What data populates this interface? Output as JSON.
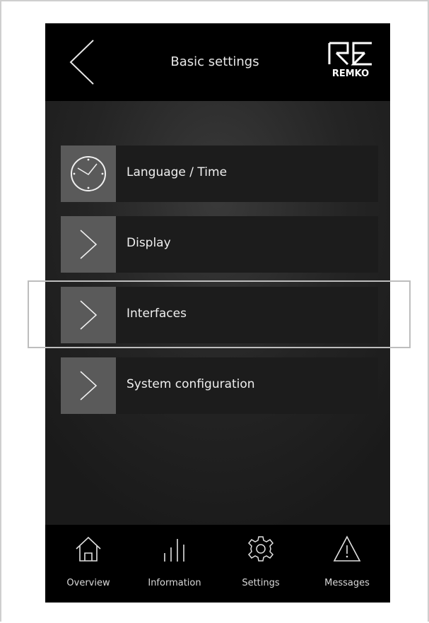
{
  "header": {
    "title": "Basic settings",
    "logo_text": "REMKO"
  },
  "menu": {
    "items": [
      {
        "label": "Language / Time",
        "icon": "clock-icon"
      },
      {
        "label": "Display",
        "icon": "chevron-right-icon"
      },
      {
        "label": "Interfaces",
        "icon": "chevron-right-icon",
        "highlighted": true
      },
      {
        "label": "System configuration",
        "icon": "chevron-right-icon"
      }
    ]
  },
  "footer": {
    "nav": [
      {
        "label": "Overview",
        "icon": "home-icon"
      },
      {
        "label": "Information",
        "icon": "bars-icon"
      },
      {
        "label": "Settings",
        "icon": "gear-icon"
      },
      {
        "label": "Messages",
        "icon": "warning-icon"
      }
    ]
  },
  "colors": {
    "header_bg": "#000000",
    "item_bg": "#1c1c1c",
    "icon_box_bg": "#5a5a5a",
    "text": "#efefef"
  }
}
